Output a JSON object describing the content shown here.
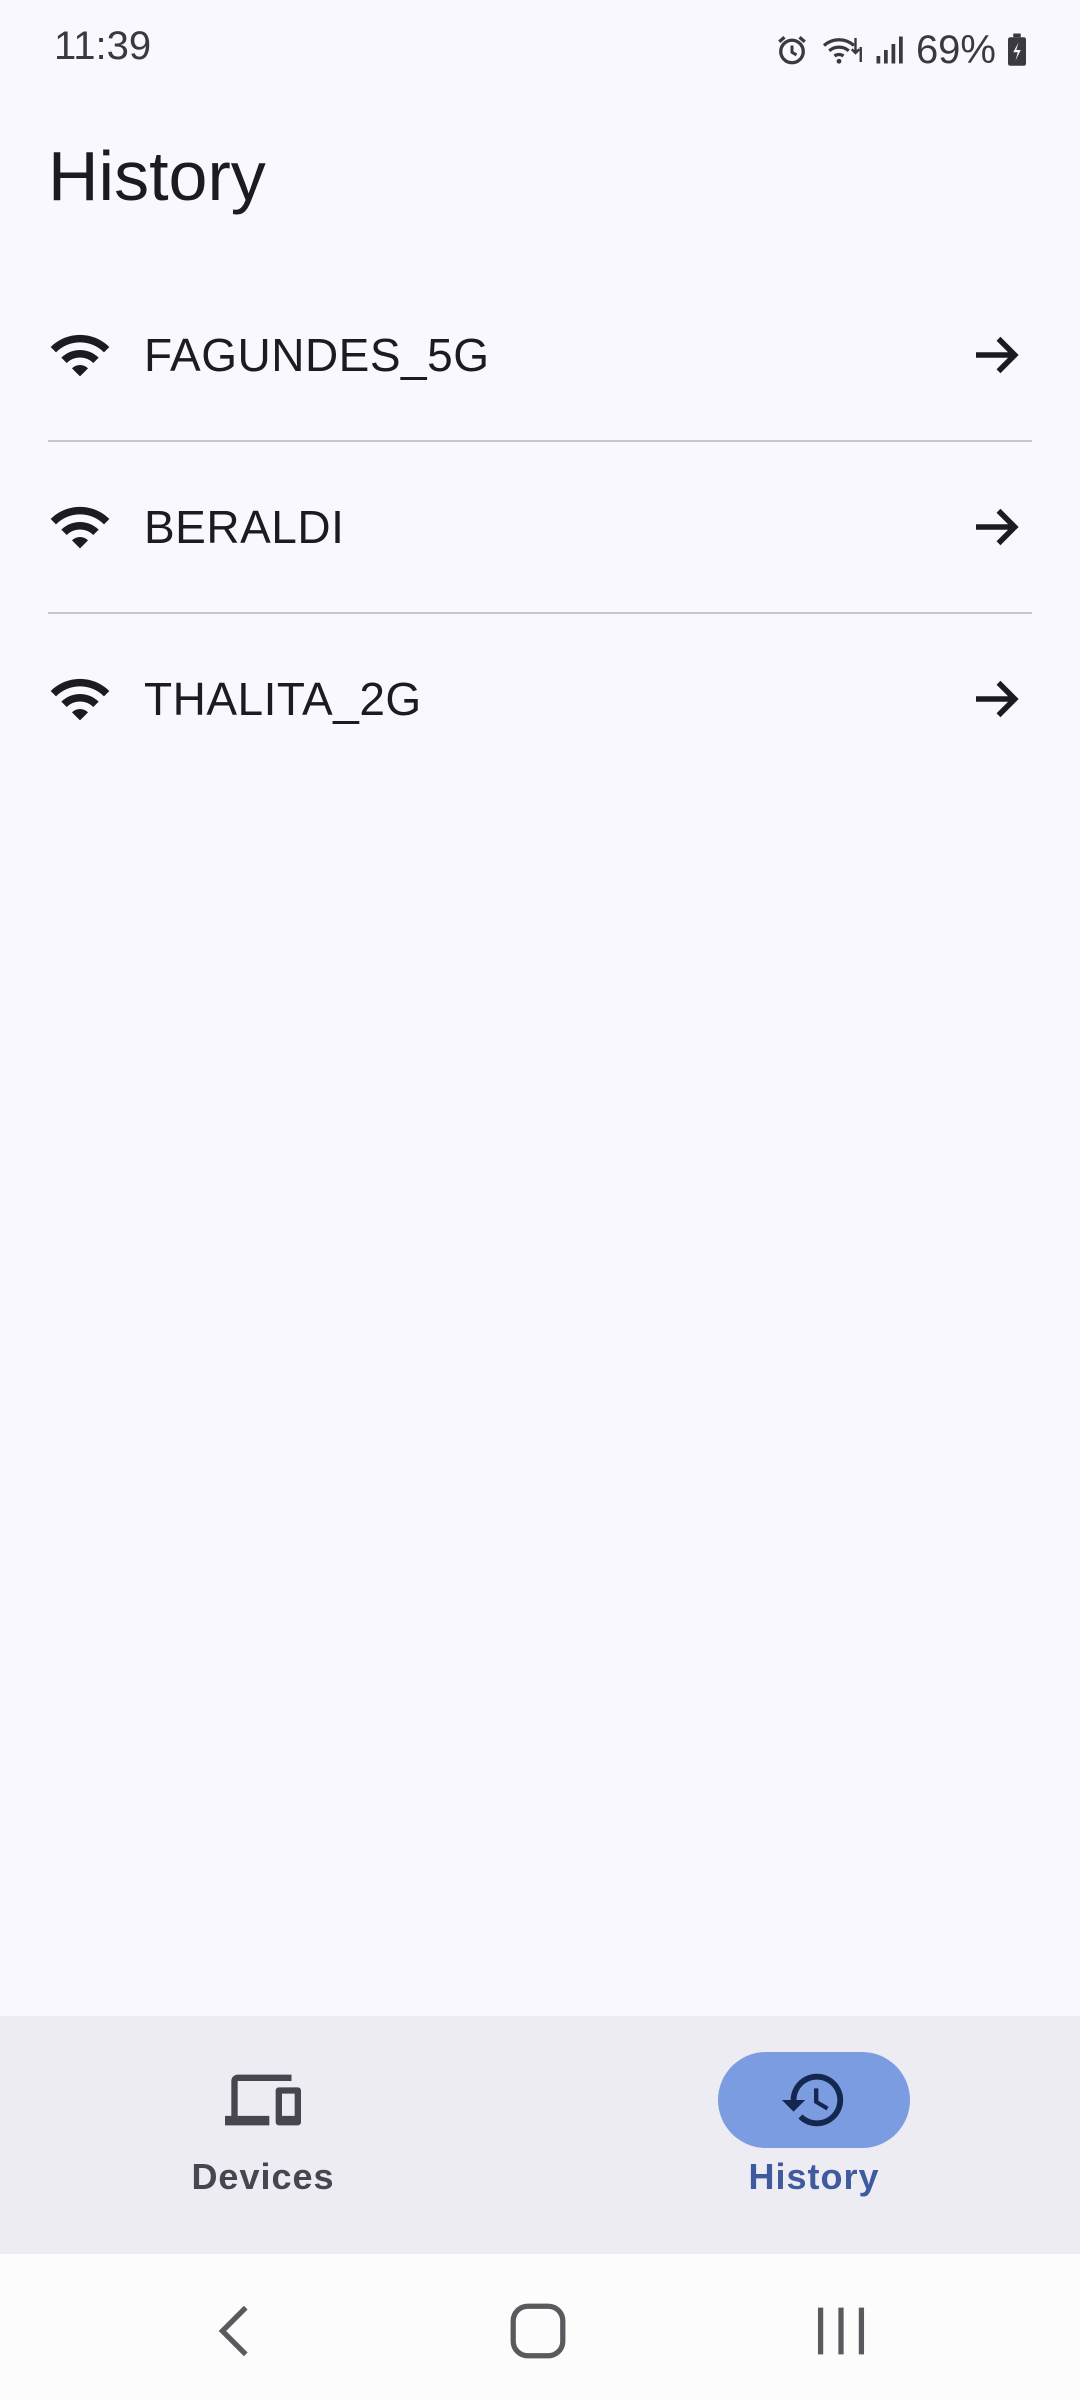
{
  "status_bar": {
    "time": "11:39",
    "battery": "69%",
    "icons": [
      "alarm-icon",
      "wifi-data-icon",
      "cellular-signal-icon",
      "battery-charging-icon"
    ]
  },
  "page": {
    "title": "History"
  },
  "networks": [
    {
      "name": "FAGUNDES_5G",
      "icon": "wifi-icon",
      "action_icon": "arrow-forward-icon"
    },
    {
      "name": "BERALDI",
      "icon": "wifi-icon",
      "action_icon": "arrow-forward-icon"
    },
    {
      "name": "THALITA_2G",
      "icon": "wifi-icon",
      "action_icon": "arrow-forward-icon"
    }
  ],
  "bottom_nav": {
    "items": [
      {
        "label": "Devices",
        "icon": "devices-icon",
        "selected": false
      },
      {
        "label": "History",
        "icon": "history-icon",
        "selected": true
      }
    ]
  },
  "system_nav": {
    "buttons": [
      "back-icon",
      "home-icon",
      "recents-icon"
    ]
  },
  "colors": {
    "background": "#f8f8fe",
    "nav_background": "#ececf2",
    "nav_active_indicator": "#7b9ce0",
    "nav_active_label": "#3f5a9f",
    "text_primary": "#1c1b20",
    "divider": "#c5c5cc"
  }
}
